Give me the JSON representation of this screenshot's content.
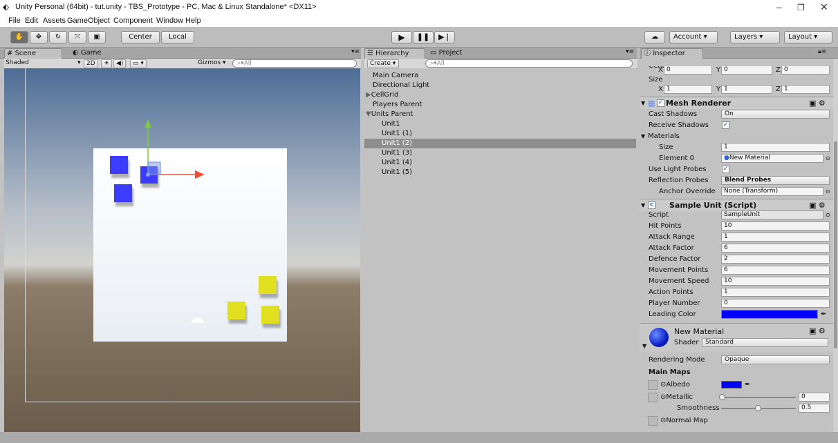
{
  "title": "Unity Personal (64bit) - tut.unity - TBS_Prototype - PC, Mac & Linux Standalone* <DX11>",
  "window_controls": [
    "–",
    "❐",
    "✕"
  ],
  "menu": [
    "File",
    "Edit",
    "Assets",
    "GameObject",
    "Component",
    "Window",
    "Help"
  ],
  "toolbar": {
    "center": "Center",
    "local": "Local",
    "account": "Account",
    "layers": "Layers",
    "layout": "Layout"
  },
  "scene_tabs": {
    "scene": "Scene",
    "game": "Game",
    "shaded": "Shaded",
    "mode2d": "2D",
    "gizmos": "Gizmos",
    "search": "All"
  },
  "hierarchy": {
    "tab": "Hierarchy",
    "tab2": "Project",
    "create": "Create",
    "search": "All",
    "items": [
      "Main Camera",
      "Directional Light",
      "CellGrid",
      "Players Parent",
      "Units Parent",
      "Unit1",
      "Unit1 (1)",
      "Unit1 (2)",
      "Unit1 (3)",
      "Unit1 (4)",
      "Unit1 (5)"
    ]
  },
  "inspector": {
    "tab": "Inspector",
    "center": "Center",
    "size": "Size",
    "cx": "0",
    "cy": "0",
    "cz": "0",
    "sx": "1",
    "sy": "1",
    "sz": "1",
    "mesh_renderer": "Mesh Renderer",
    "cast_shadows": "Cast Shadows",
    "cast_shadows_val": "On",
    "receive_shadows": "Receive Shadows",
    "materials": "Materials",
    "mat_size": "Size",
    "mat_size_val": "1",
    "element0": "Element 0",
    "element0_val": "New Material",
    "light_probes": "Use Light Probes",
    "reflection_probes": "Reflection Probes",
    "reflection_val": "Blend Probes",
    "anchor": "Anchor Override",
    "anchor_val": "None (Transform)",
    "script_header": "Sample Unit (Script)",
    "script": "Script",
    "script_val": "SampleUnit",
    "fields": [
      [
        "Hit Points",
        "10"
      ],
      [
        "Attack Range",
        "1"
      ],
      [
        "Attack Factor",
        "6"
      ],
      [
        "Defence Factor",
        "2"
      ],
      [
        "Movement Points",
        "6"
      ],
      [
        "Movement Speed",
        "10"
      ],
      [
        "Action Points",
        "1"
      ],
      [
        "Player Number",
        "0"
      ]
    ],
    "leading_color": "Leading Color",
    "leading_color_hex": "#0000ff",
    "material_name": "New Material",
    "shader": "Shader",
    "shader_val": "Standard",
    "rendering_mode": "Rendering Mode",
    "rendering_val": "Opaque",
    "main_maps": "Main Maps",
    "albedo": "Albedo",
    "metallic": "Metallic",
    "metallic_val": "0",
    "smoothness": "Smoothness",
    "smoothness_val": "0.5",
    "normal_map": "Normal Map"
  }
}
